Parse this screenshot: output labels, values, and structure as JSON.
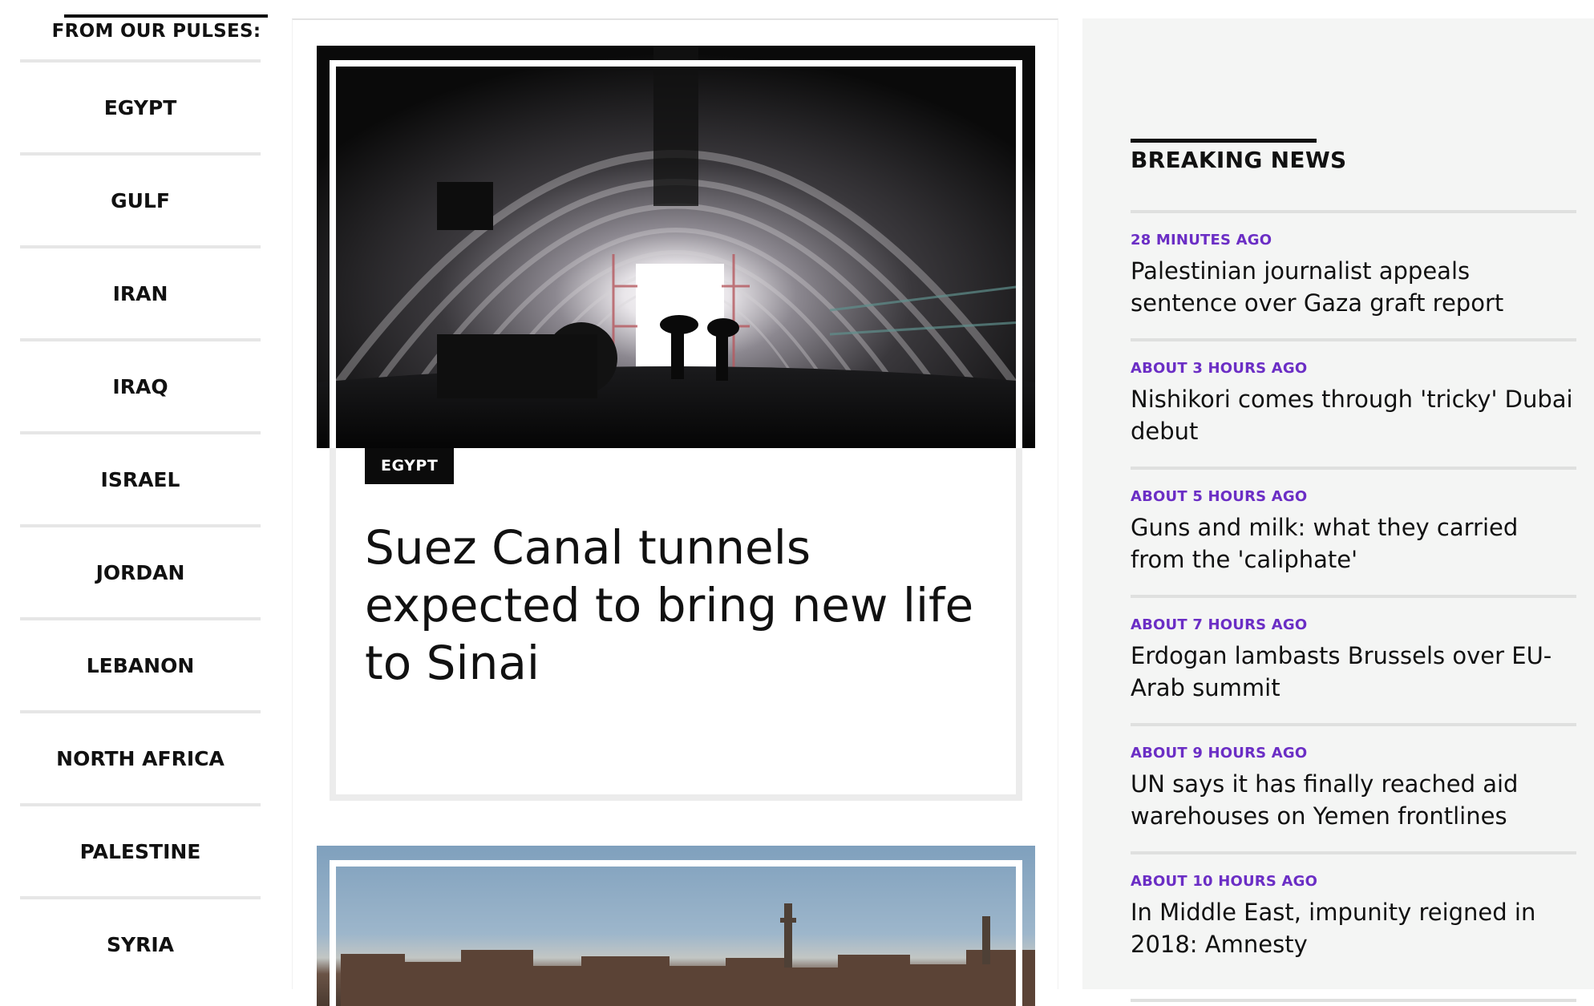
{
  "pulses": {
    "heading": "FROM OUR PULSES:",
    "items": [
      "EGYPT",
      "GULF",
      "IRAN",
      "IRAQ",
      "ISRAEL",
      "JORDAN",
      "LEBANON",
      "NORTH AFRICA",
      "PALESTINE",
      "SYRIA"
    ]
  },
  "feed": {
    "cards": [
      {
        "category": "EGYPT",
        "title": "Suez Canal tunnels expected to bring new life to Sinai"
      }
    ]
  },
  "breaking_news": {
    "heading": "BREAKING NEWS",
    "items": [
      {
        "time": "28 MINUTES AGO",
        "headline": "Palestinian journalist appeals sentence over Gaza graft report"
      },
      {
        "time": "ABOUT 3 HOURS AGO",
        "headline": "Nishikori comes through 'tricky' Dubai debut"
      },
      {
        "time": "ABOUT 5 HOURS AGO",
        "headline": "Guns and milk: what they carried from the 'caliphate'"
      },
      {
        "time": "ABOUT 7 HOURS AGO",
        "headline": "Erdogan lambasts Brussels over EU-Arab summit"
      },
      {
        "time": "ABOUT 9 HOURS AGO",
        "headline": "UN says it has finally reached aid warehouses on Yemen frontlines"
      },
      {
        "time": "ABOUT 10 HOURS AGO",
        "headline": "In Middle East, impunity reigned in 2018: Amnesty"
      }
    ]
  },
  "colors": {
    "accent_time": "#6b2ec5",
    "sidebar_bg": "#f4f5f4"
  }
}
